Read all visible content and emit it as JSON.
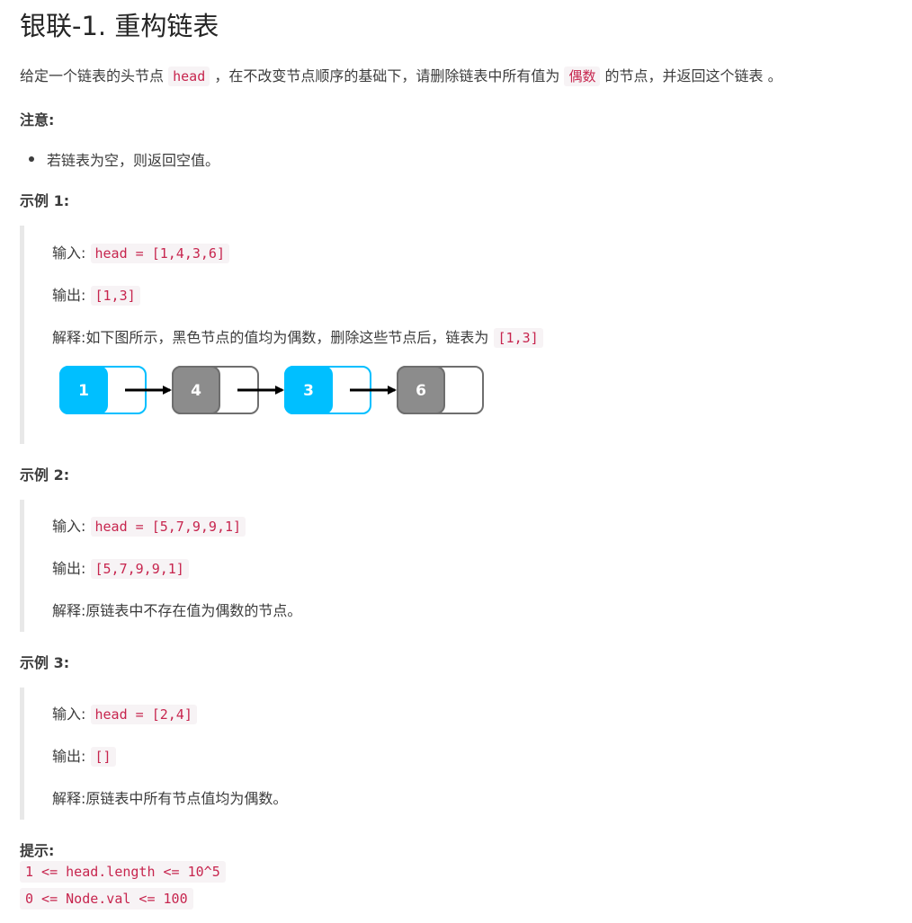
{
  "title": "银联-1. 重构链表",
  "description": {
    "part1": "给定一个链表的头节点",
    "code1": "head",
    "part2": "，在不改变节点顺序的基础下，请删除链表中所有值为",
    "code2": "偶数",
    "part3": "的节点，并返回这个链表 。"
  },
  "note": {
    "label": "注意:",
    "items": [
      "若链表为空，则返回空值。"
    ]
  },
  "labels": {
    "input": "输入:",
    "output": "输出:",
    "explain": "解释:"
  },
  "examples": [
    {
      "title": "示例 1:",
      "input": "head = [1,4,3,6]",
      "output": "[1,3]",
      "explain_text": "如下图所示，黑色节点的值均为偶数，删除这些节点后，链表为",
      "explain_code": "[1,3]",
      "diagram": {
        "nodes": [
          {
            "value": "1",
            "color": "#00bfff"
          },
          {
            "value": "4",
            "color": "#8c8c8c"
          },
          {
            "value": "3",
            "color": "#00bfff"
          },
          {
            "value": "6",
            "color": "#8c8c8c"
          }
        ]
      }
    },
    {
      "title": "示例 2:",
      "input": "head = [5,7,9,9,1]",
      "output": "[5,7,9,9,1]",
      "explain_text": "原链表中不存在值为偶数的节点。"
    },
    {
      "title": "示例 3:",
      "input": "head = [2,4]",
      "output": "[]",
      "explain_text": "原链表中所有节点值均为偶数。"
    }
  ],
  "hints": {
    "label": "提示:",
    "items": [
      "1 <= head.length <= 10^5",
      "0 <= Node.val <= 100"
    ]
  },
  "colors": {
    "odd_node": "#00bfff",
    "even_node": "#8c8c8c",
    "code_text": "#c7254e"
  }
}
